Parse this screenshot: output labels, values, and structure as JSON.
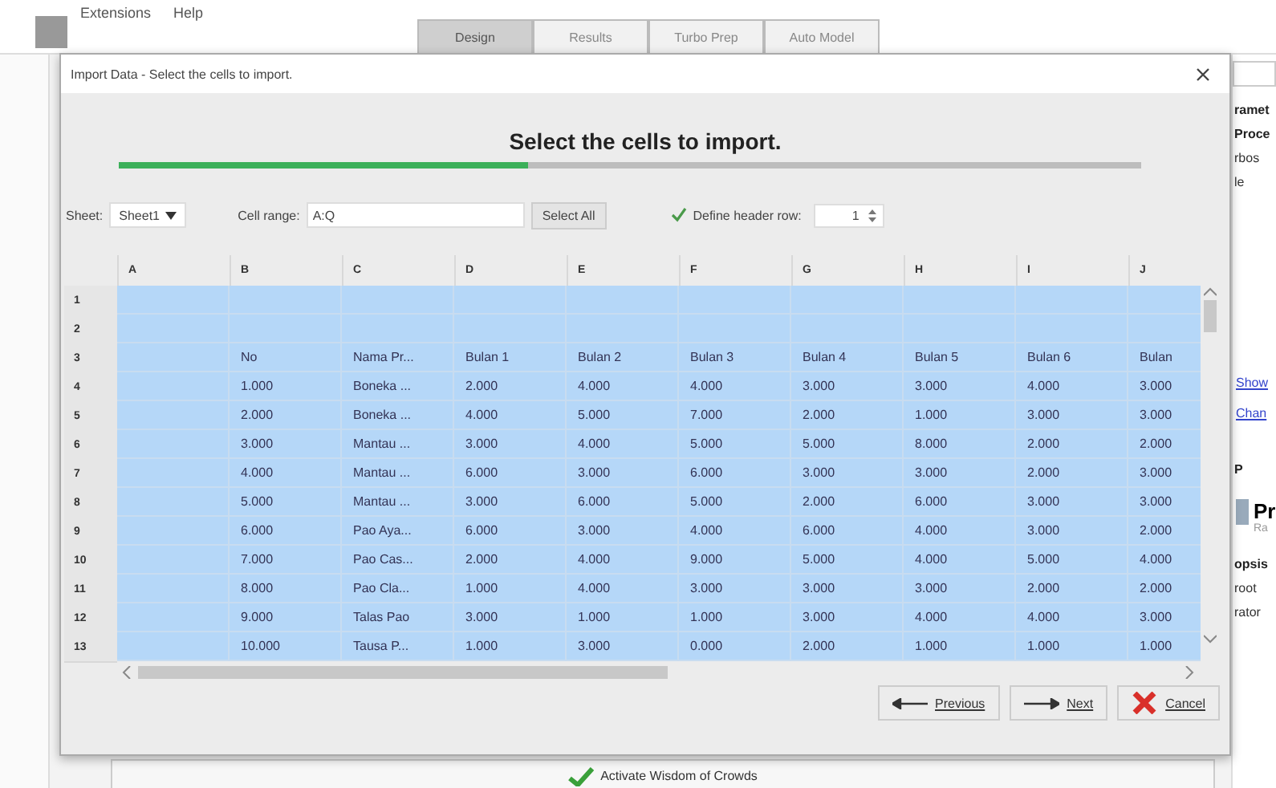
{
  "menu": [
    "Extensions",
    "Help"
  ],
  "tabs": [
    {
      "label": "Design",
      "selected": true
    },
    {
      "label": "Results",
      "selected": false
    },
    {
      "label": "Turbo Prep",
      "selected": false
    },
    {
      "label": "Auto Model",
      "selected": false
    }
  ],
  "side_panel": {
    "headings": [
      "ramet",
      "Proce"
    ],
    "texts": [
      "rbos",
      "le"
    ],
    "links": [
      "Show",
      "Chan"
    ],
    "section": "P",
    "item_title": "Pr",
    "item_sub": "Ra",
    "footer_heading": "opsis",
    "footer_lines": [
      "root",
      "rator"
    ]
  },
  "dialog": {
    "title": "Import Data - Select the cells to import.",
    "heading": "Select the cells to import.",
    "progress": {
      "level": 0.4
    },
    "sheet": {
      "label": "Sheet:",
      "value": "Sheet1"
    },
    "cell_range": {
      "label": "Cell range:",
      "value": "A:Q"
    },
    "select_all": "Select All",
    "header_row": {
      "label": "Define header row:",
      "checked": true,
      "value": "1"
    },
    "table": {
      "columns": [
        "A",
        "B",
        "C",
        "D",
        "E",
        "F",
        "G",
        "H",
        "I",
        "J"
      ],
      "rows": [
        {
          "number": "1",
          "selected": true,
          "cells": []
        },
        {
          "number": "2",
          "selected": true,
          "cells": []
        },
        {
          "number": "3",
          "selected": true,
          "cells": [
            null,
            "No",
            "Nama Pr...",
            "Bulan 1",
            "Bulan 2",
            "Bulan 3",
            "Bulan 4",
            "Bulan 5",
            "Bulan 6",
            "Bulan"
          ]
        },
        {
          "number": "4",
          "selected": true,
          "cells": [
            null,
            "1.000",
            "Boneka ...",
            "2.000",
            "4.000",
            "4.000",
            "3.000",
            "3.000",
            "4.000",
            "3.000"
          ]
        },
        {
          "number": "5",
          "selected": true,
          "cells": [
            null,
            "2.000",
            "Boneka ...",
            "4.000",
            "5.000",
            "7.000",
            "2.000",
            "1.000",
            "3.000",
            "3.000"
          ]
        },
        {
          "number": "6",
          "selected": true,
          "cells": [
            null,
            "3.000",
            "Mantau ...",
            "3.000",
            "4.000",
            "5.000",
            "5.000",
            "8.000",
            "2.000",
            "2.000"
          ]
        },
        {
          "number": "7",
          "selected": true,
          "cells": [
            null,
            "4.000",
            "Mantau ...",
            "6.000",
            "3.000",
            "6.000",
            "3.000",
            "3.000",
            "2.000",
            "3.000"
          ]
        },
        {
          "number": "8",
          "selected": true,
          "cells": [
            null,
            "5.000",
            "Mantau ...",
            "3.000",
            "6.000",
            "5.000",
            "2.000",
            "6.000",
            "3.000",
            "3.000"
          ]
        },
        {
          "number": "9",
          "selected": true,
          "cells": [
            null,
            "6.000",
            "Pao Aya...",
            "6.000",
            "3.000",
            "4.000",
            "6.000",
            "4.000",
            "3.000",
            "2.000"
          ]
        },
        {
          "number": "10",
          "selected": true,
          "cells": [
            null,
            "7.000",
            "Pao Cas...",
            "2.000",
            "4.000",
            "9.000",
            "5.000",
            "4.000",
            "5.000",
            "4.000"
          ]
        },
        {
          "number": "11",
          "selected": true,
          "cells": [
            null,
            "8.000",
            "Pao Cla...",
            "1.000",
            "4.000",
            "3.000",
            "3.000",
            "3.000",
            "2.000",
            "2.000"
          ]
        },
        {
          "number": "12",
          "selected": true,
          "cells": [
            null,
            "9.000",
            "Talas Pao",
            "3.000",
            "1.000",
            "1.000",
            "3.000",
            "4.000",
            "4.000",
            "3.000"
          ]
        },
        {
          "number": "13",
          "selected": true,
          "cells": [
            null,
            "10.000",
            "Tausa P...",
            "1.000",
            "3.000",
            "0.000",
            "2.000",
            "1.000",
            "1.000",
            "1.000"
          ]
        }
      ]
    },
    "buttons": [
      {
        "kind": "previous",
        "label": "Previous"
      },
      {
        "kind": "next",
        "label": "Next"
      },
      {
        "kind": "cancel",
        "label": "Cancel"
      }
    ]
  },
  "bottom_button": "Activate Wisdom of Crowds"
}
